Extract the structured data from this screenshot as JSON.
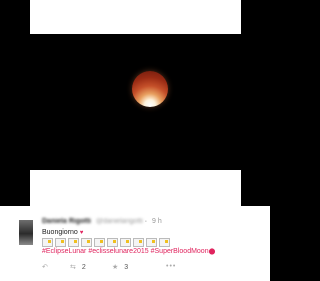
{
  "tweet": {
    "display_name": "Daniela Rigotti",
    "handle": "@danielarigotti",
    "separator": "·",
    "time": "9 h",
    "text": "Buongiorno",
    "emoji_count": 10,
    "hashtags": [
      "#EclipseLunar",
      "#eclisselunare2015",
      "#SuperBloodMoon"
    ],
    "actions": {
      "reply_icon": "reply-icon",
      "retweet_icon": "retweet-icon",
      "retweet_count": "2",
      "like_icon": "star-icon",
      "like_count": "3",
      "more_icon": "more-icon"
    }
  },
  "colors": {
    "hashtag": "#e0245e",
    "background": "#000000",
    "card": "#ffffff"
  }
}
